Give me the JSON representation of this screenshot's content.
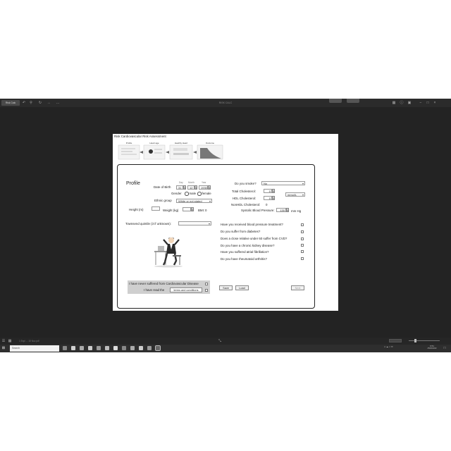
{
  "browser": {
    "back_label": "Risk Calc",
    "title": "RISK CALC"
  },
  "window": {
    "title": "Risk Cardiovascular Risk Assessment",
    "banner_steps": [
      "Profile",
      "Heart age",
      "Healthy Heart",
      "Outcome"
    ]
  },
  "profile": {
    "heading": "Profile",
    "dob_label": "Date of Birth",
    "dob_col_day": "Day",
    "dob_col_month": "Month",
    "dob_col_year": "Year",
    "dob_day": "31",
    "dob_month": "12",
    "dob_year": "1930",
    "gender_label": "Gender",
    "gender_male": "male",
    "gender_female": "female",
    "ethnic_label": "Ethnic group",
    "ethnic_value": "White or not stated",
    "height_label": "Height (m)",
    "weight_label": "Weight (kg)",
    "bmi_label": "BMI:",
    "bmi_value": "0",
    "postcode_label": "Townsend quintile (3 if unknown):"
  },
  "right": {
    "smoke_label": "Do you smoke?",
    "smoke_value": "No",
    "total_chol_label": "Total Cholesterol:",
    "total_chol_value": "0",
    "chol_unit": "mmol/L",
    "hdl_label": "HDL Cholesterol:",
    "hdl_value": "0",
    "nonhdl_label": "NonHDL Cholesterol:",
    "nonhdl_value": "0",
    "sbp_label": "Systolic Blood Pressure:",
    "sbp_value": "130",
    "sbp_unit": "mm Hg",
    "questions": [
      "Have you received blood pressure treatment?",
      "Do you suffer from diabetes?",
      "Does a close relative under 60 suffer from CVD?",
      "Do you have a chronic kidney disease?",
      "Have you suffered atrial fibrillation?",
      "Do you have rheumatoid arthritis?"
    ]
  },
  "consent": {
    "never_label": "I have never suffered from Cardiovascular Disease",
    "read_label": "I have read the",
    "terms_button": "terms and conditions"
  },
  "actions": {
    "save": "Save",
    "load": "Load",
    "next": "Next"
  },
  "status_bar": {
    "path": "1 Expl ... 15 Nov.pdf"
  },
  "taskbar": {
    "search_placeholder": "Search",
    "time": "9:51",
    "date": "25/06/2023"
  }
}
